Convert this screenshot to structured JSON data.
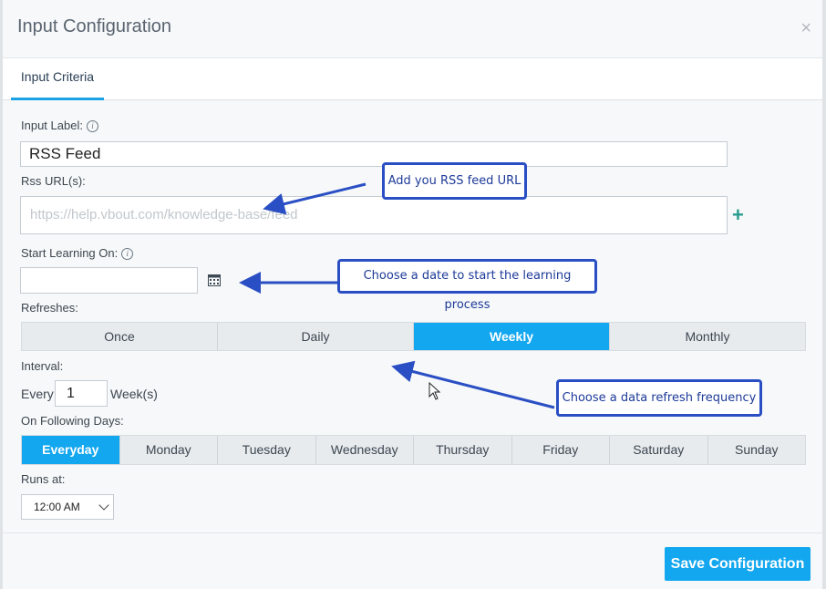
{
  "modal": {
    "title": "Input Configuration",
    "close_glyph": "×"
  },
  "tabs": [
    {
      "label": "Input Criteria",
      "active": true
    }
  ],
  "form": {
    "input_label": {
      "label": "Input Label:",
      "value": "RSS Feed"
    },
    "rss": {
      "label": "Rss URL(s):",
      "placeholder": "https://help.vbout.com/knowledge-base/feed",
      "add_glyph": "+"
    },
    "start": {
      "label": "Start Learning On:",
      "value": ""
    },
    "refreshes": {
      "label": "Refreshes:",
      "options": [
        "Once",
        "Daily",
        "Weekly",
        "Monthly"
      ],
      "selected": "Weekly"
    },
    "interval": {
      "label": "Interval:",
      "prefix": "Every",
      "value": "1",
      "suffix": "Week(s)"
    },
    "days": {
      "label": "On Following Days:",
      "options": [
        "Everyday",
        "Monday",
        "Tuesday",
        "Wednesday",
        "Thursday",
        "Friday",
        "Saturday",
        "Sunday"
      ],
      "selected": "Everyday"
    },
    "runs_at": {
      "label": "Runs at:",
      "value": "12:00 AM"
    }
  },
  "footer": {
    "save_label": "Save Configuration"
  },
  "annotations": {
    "url_hint": "Add you RSS feed URL",
    "date_hint": "Choose a date to start the learning process",
    "refresh_hint": "Choose a data refresh frequency"
  },
  "colors": {
    "accent": "#13a7ef",
    "callout_border": "#2a4fc4",
    "plus": "#2a9d8f"
  },
  "icons": {
    "info": "info-icon",
    "calendar": "calendar-icon",
    "close": "close-icon",
    "add": "plus-icon",
    "dropdown": "chevron-down-icon"
  }
}
